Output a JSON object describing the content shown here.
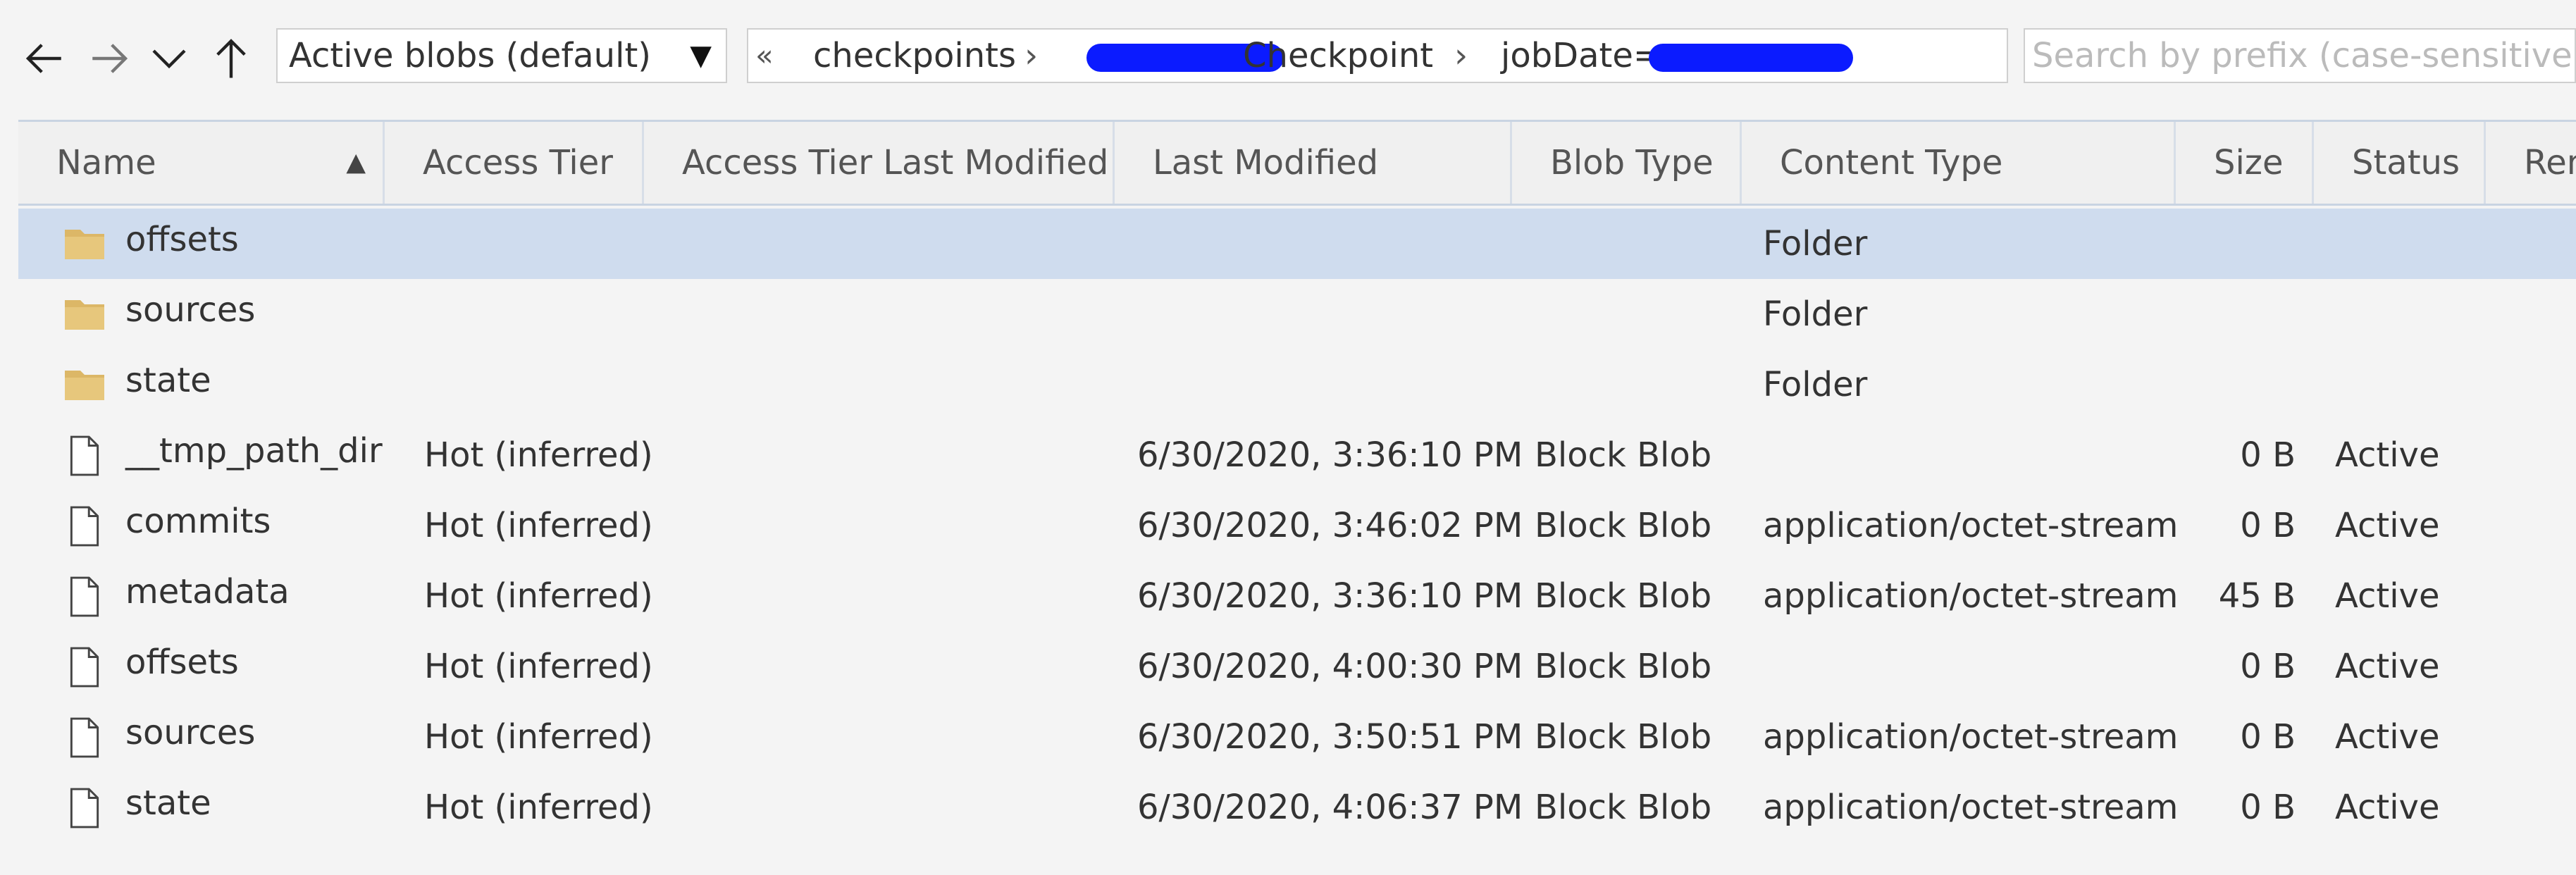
{
  "toolbar": {
    "back_icon": "arrow-left-icon",
    "forward_icon": "arrow-right-icon",
    "recent_icon": "chevron-down-icon",
    "up_icon": "arrow-up-icon",
    "view_filter": "Active blobs (default)",
    "breadcrumb": {
      "overflow": "«",
      "items": [
        "checkpoints",
        "Checkpoint",
        "jobDate="
      ]
    },
    "search_placeholder": "Search by prefix (case-sensitive)"
  },
  "grid": {
    "columns": [
      "Name",
      "Access Tier",
      "Access Tier Last Modified",
      "Last Modified",
      "Blob Type",
      "Content Type",
      "Size",
      "Status",
      "Rem"
    ],
    "rows": [
      {
        "type": "folder",
        "name": "offsets",
        "access_tier": "",
        "tier_modified": "",
        "last_modified": "",
        "blob_type": "",
        "content_type": "Folder",
        "size": "",
        "status": ""
      },
      {
        "type": "folder",
        "name": "sources",
        "access_tier": "",
        "tier_modified": "",
        "last_modified": "",
        "blob_type": "",
        "content_type": "Folder",
        "size": "",
        "status": ""
      },
      {
        "type": "folder",
        "name": "state",
        "access_tier": "",
        "tier_modified": "",
        "last_modified": "",
        "blob_type": "",
        "content_type": "Folder",
        "size": "",
        "status": ""
      },
      {
        "type": "file",
        "name": "__tmp_path_dir",
        "access_tier": "Hot (inferred)",
        "tier_modified": "",
        "last_modified": "6/30/2020, 3:36:10 PM",
        "blob_type": "Block Blob",
        "content_type": "",
        "size": "0 B",
        "status": "Active"
      },
      {
        "type": "file",
        "name": "commits",
        "access_tier": "Hot (inferred)",
        "tier_modified": "",
        "last_modified": "6/30/2020, 3:46:02 PM",
        "blob_type": "Block Blob",
        "content_type": "application/octet-stream",
        "size": "0 B",
        "status": "Active"
      },
      {
        "type": "file",
        "name": "metadata",
        "access_tier": "Hot (inferred)",
        "tier_modified": "",
        "last_modified": "6/30/2020, 3:36:10 PM",
        "blob_type": "Block Blob",
        "content_type": "application/octet-stream",
        "size": "45 B",
        "status": "Active"
      },
      {
        "type": "file",
        "name": "offsets",
        "access_tier": "Hot (inferred)",
        "tier_modified": "",
        "last_modified": "6/30/2020, 4:00:30 PM",
        "blob_type": "Block Blob",
        "content_type": "",
        "size": "0 B",
        "status": "Active"
      },
      {
        "type": "file",
        "name": "sources",
        "access_tier": "Hot (inferred)",
        "tier_modified": "",
        "last_modified": "6/30/2020, 3:50:51 PM",
        "blob_type": "Block Blob",
        "content_type": "application/octet-stream",
        "size": "0 B",
        "status": "Active"
      },
      {
        "type": "file",
        "name": "state",
        "access_tier": "Hot (inferred)",
        "tier_modified": "",
        "last_modified": "6/30/2020, 4:06:37 PM",
        "blob_type": "Block Blob",
        "content_type": "application/octet-stream",
        "size": "0 B",
        "status": "Active"
      }
    ],
    "selected_row": 0
  },
  "colors": {
    "selected_row": "#cfdcee",
    "folder": "#dcb767",
    "redaction": "#0b1bff"
  }
}
